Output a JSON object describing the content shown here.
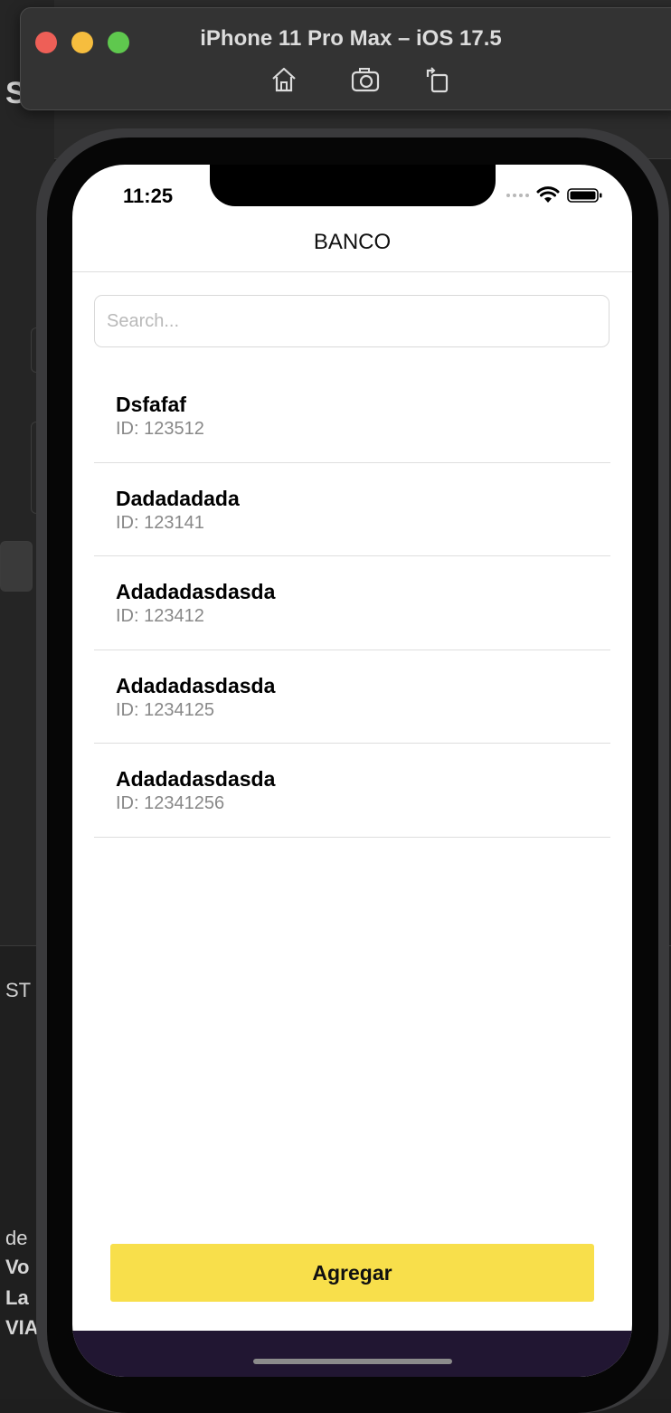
{
  "simulator": {
    "title": "iPhone 11 Pro Max – iOS 17.5",
    "toolbar": [
      "home-icon",
      "screenshot-icon",
      "rotate-icon"
    ]
  },
  "background": {
    "header_letter": "S",
    "status_label": "ST",
    "text_lines": [
      "de",
      "Vo",
      "La",
      "VIA"
    ]
  },
  "status_bar": {
    "time": "11:25"
  },
  "nav": {
    "title": "BANCO"
  },
  "search": {
    "placeholder": "Search..."
  },
  "items": [
    {
      "name": "Dsfafaf",
      "id": "ID: 123512"
    },
    {
      "name": "Dadadadada",
      "id": "ID: 123141"
    },
    {
      "name": "Adadadasdasda",
      "id": "ID: 123412"
    },
    {
      "name": "Adadadasdasda",
      "id": "ID: 1234125"
    },
    {
      "name": "Adadadasdasda",
      "id": "ID: 12341256"
    }
  ],
  "add_button": {
    "label": "Agregar"
  },
  "colors": {
    "button_bg": "#f8df4b",
    "bottom_bar": "#211632",
    "id_text": "#888888"
  }
}
